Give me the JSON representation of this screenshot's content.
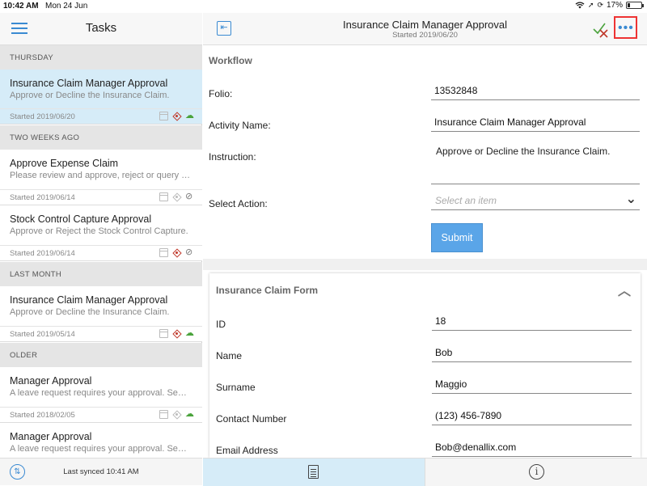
{
  "status_bar": {
    "time": "10:42 AM",
    "date": "Mon 24 Jun",
    "battery": "17%",
    "battery_level": 0.17
  },
  "left": {
    "title": "Tasks",
    "sections": [
      {
        "label": "THURSDAY",
        "tasks": [
          {
            "title": "Insurance Claim Manager Approval",
            "desc": "Approve or Decline the Insurance Claim.",
            "started": "Started 2019/06/20",
            "icons": [
              "calendar-icon",
              "diamond-icon",
              "cloud-icon"
            ],
            "selected": true
          }
        ]
      },
      {
        "label": "TWO WEEKS AGO",
        "tasks": [
          {
            "title": "Approve Expense Claim",
            "desc": "Please review and approve, reject or query the expense claim.",
            "started": "Started 2019/06/14",
            "icons": [
              "calendar-icon",
              "diamond-grey-icon",
              "eye-off-icon"
            ]
          },
          {
            "title": "Stock Control Capture Approval",
            "desc": "Approve or Reject the Stock Control Capture.",
            "started": "Started 2019/06/14",
            "icons": [
              "calendar-icon",
              "diamond-icon",
              "eye-off-icon"
            ]
          }
        ]
      },
      {
        "label": "LAST MONTH",
        "tasks": [
          {
            "title": "Insurance Claim Manager Approval",
            "desc": "Approve or Decline the Insurance Claim.",
            "started": "Started 2019/05/14",
            "icons": [
              "calendar-icon",
              "diamond-icon",
              "cloud-icon"
            ]
          }
        ]
      },
      {
        "label": "OLDER",
        "tasks": [
          {
            "title": "Manager Approval",
            "desc": "A leave request requires your approval. See details below.",
            "started": "Started 2018/02/05",
            "icons": [
              "calendar-icon",
              "diamond-grey-icon",
              "cloud-icon"
            ]
          },
          {
            "title": "Manager Approval",
            "desc": "A leave request requires your approval. See details below.",
            "started": "",
            "icons": []
          }
        ]
      }
    ],
    "footer": {
      "sync_text": "Last synced 10:41 AM"
    }
  },
  "right": {
    "header": {
      "title": "Insurance Claim Manager Approval",
      "subtitle": "Started 2019/06/20"
    },
    "workflow": {
      "title": "Workflow",
      "folio_label": "Folio:",
      "folio_value": "13532848",
      "activity_label": "Activity Name:",
      "activity_value": "Insurance Claim Manager Approval",
      "instruction_label": "Instruction:",
      "instruction_value": "Approve or Decline the Insurance Claim.",
      "action_label": "Select Action:",
      "action_placeholder": "Select an item",
      "submit_label": "Submit"
    },
    "form": {
      "title": "Insurance Claim Form",
      "fields": [
        {
          "label": "ID",
          "value": "18"
        },
        {
          "label": "Name",
          "value": "Bob"
        },
        {
          "label": "Surname",
          "value": "Maggio"
        },
        {
          "label": "Contact Number",
          "value": "(123) 456-7890"
        },
        {
          "label": "Email Address",
          "value": "Bob@denallix.com"
        }
      ]
    }
  }
}
